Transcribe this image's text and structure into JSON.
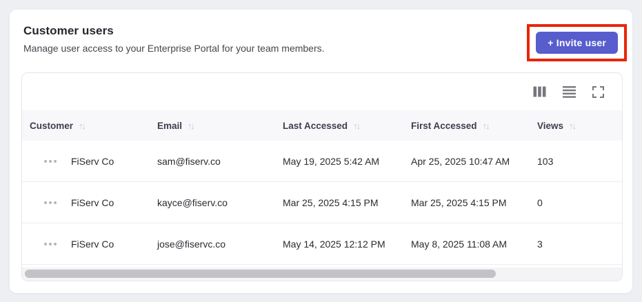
{
  "header": {
    "title": "Customer users",
    "subtitle": "Manage user access to your Enterprise Portal for your team members.",
    "invite_button_label": "+ Invite user"
  },
  "toolbar": {
    "icons": [
      "columns-icon",
      "row-density-icon",
      "fullscreen-icon"
    ]
  },
  "table": {
    "columns": [
      "Customer",
      "Email",
      "Last Accessed",
      "First Accessed",
      "Views"
    ],
    "sort_icon": "↑↓",
    "row_menu_icon": "ellipsis-icon",
    "rows": [
      {
        "customer": "FiServ Co",
        "email": "sam@fiserv.co",
        "last_accessed": "May 19, 2025 5:42 AM",
        "first_accessed": "Apr 25, 2025 10:47 AM",
        "views": "103"
      },
      {
        "customer": "FiServ Co",
        "email": "kayce@fiserv.co",
        "last_accessed": "Mar 25, 2025 4:15 PM",
        "first_accessed": "Mar 25, 2025 4:15 PM",
        "views": "0"
      },
      {
        "customer": "FiServ Co",
        "email": "jose@fiservc.co",
        "last_accessed": "May 14, 2025 12:12 PM",
        "first_accessed": "May 8, 2025 11:08 AM",
        "views": "3"
      }
    ]
  },
  "scrollbar": {
    "thumb_percent": 78.5
  },
  "colors": {
    "page_background": "#edeff2",
    "card_background": "#ffffff",
    "accent_button": "#575dcd",
    "annotation_highlight": "#ea2408",
    "table_header_background": "#f8f8fb",
    "row_divider": "#ededf1",
    "icon_gray": "#76767e"
  }
}
